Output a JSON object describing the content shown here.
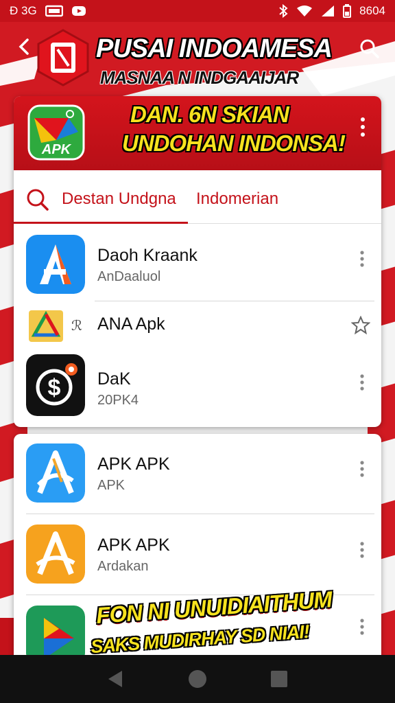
{
  "status_bar": {
    "left_text": "Ɖ 3G",
    "time": "8604",
    "icons": [
      "sim-icon",
      "calendar-icon",
      "youtube-icon",
      "bluetooth-icon",
      "wifi-icon",
      "signal-icon",
      "battery-icon"
    ]
  },
  "header": {
    "title": "PUSAI INDOAMESA",
    "subtitle": "MASNAA N INDGAAIJAR"
  },
  "banner": {
    "logo_text": "APK",
    "line1": "DAN. 6N SKIAN",
    "line2": "UNDOHAN INDONSA!"
  },
  "tabs": [
    {
      "label": "Destan Undgna",
      "active": true
    },
    {
      "label": "Indomerian",
      "active": false
    }
  ],
  "apps_card1": [
    {
      "name": "Daoh Kraank",
      "sub": "AnDaaluol",
      "icon": "a-blue-icon"
    },
    {
      "name": "ANA Apk",
      "prefix": "ℛ",
      "icon": "drive-icon"
    },
    {
      "name": "DaK",
      "sub": "20PK4",
      "icon": "dollar-icon"
    }
  ],
  "apps_card2": [
    {
      "name": "APK APK",
      "sub": "APK",
      "icon": "a-lightblue-icon"
    },
    {
      "name": "APK APK",
      "sub": "Ardakan",
      "icon": "a-orange-icon"
    },
    {
      "name": "",
      "sub": "",
      "icon": "play-triangle-icon"
    }
  ],
  "promo": {
    "line1": "FON NI UNUIDIAITHUM",
    "line2": "SAKS MUDIRHAY SD NIAI!"
  },
  "colors": {
    "brand_red": "#c4121a",
    "promo_yellow": "#f6e21e"
  }
}
